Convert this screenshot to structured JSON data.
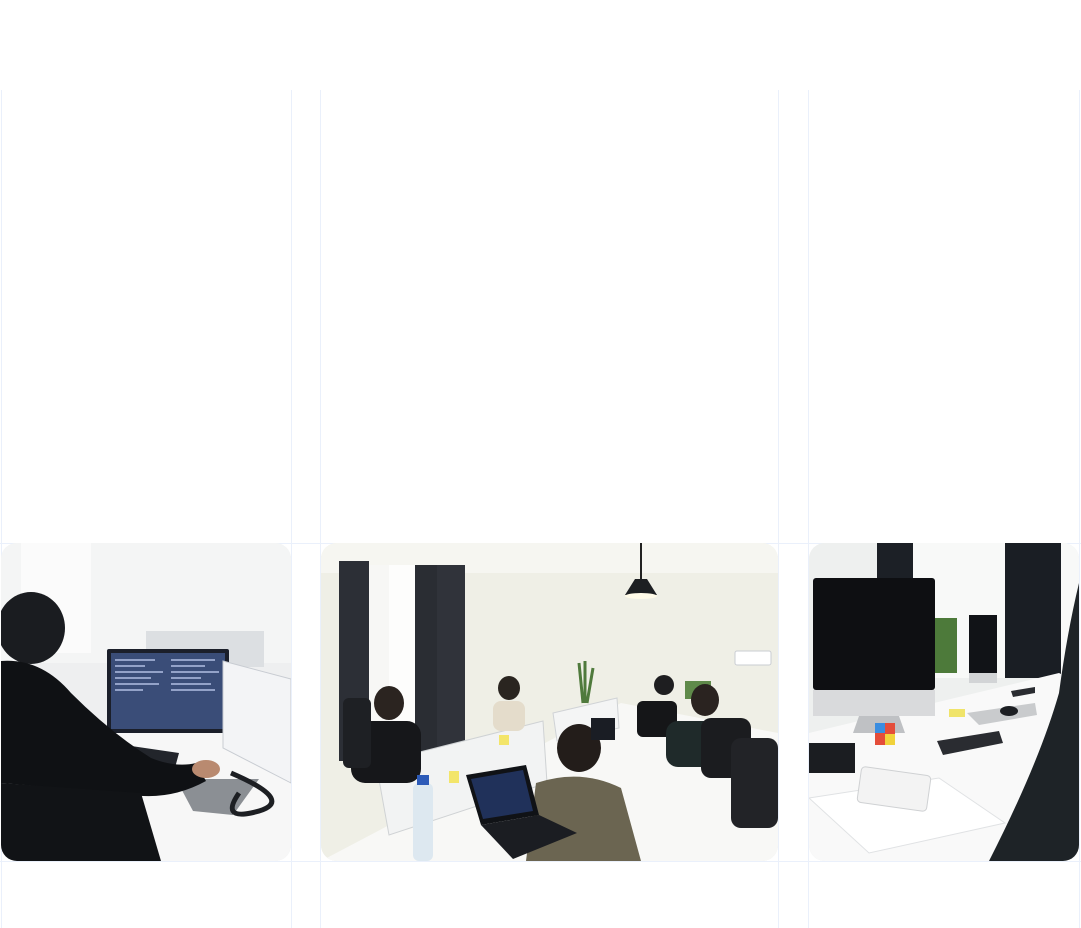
{
  "gallery": {
    "photos": [
      {
        "id": "dev-desk-photo",
        "alt": ""
      },
      {
        "id": "team-office-photo",
        "alt": ""
      },
      {
        "id": "imac-desk-photo",
        "alt": ""
      }
    ]
  }
}
